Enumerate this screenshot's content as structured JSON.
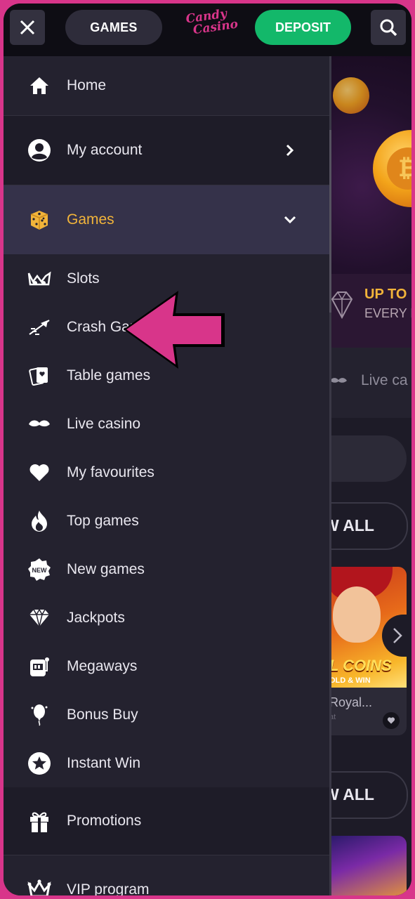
{
  "topbar": {
    "games_label": "GAMES",
    "logo_line1": "Candy",
    "logo_line2": "Casino",
    "deposit_label": "DEPOSIT"
  },
  "menu": {
    "home": "Home",
    "my_account": "My account",
    "games": "Games",
    "games_items": [
      {
        "label": "Slots",
        "icon": "slots-icon"
      },
      {
        "label": "Crash Games",
        "icon": "crash-icon"
      },
      {
        "label": "Table games",
        "icon": "cards-icon"
      },
      {
        "label": "Live casino",
        "icon": "mustache-icon"
      },
      {
        "label": "My favourites",
        "icon": "heart-icon"
      },
      {
        "label": "Top games",
        "icon": "flame-icon"
      },
      {
        "label": "New games",
        "icon": "new-badge-icon"
      },
      {
        "label": "Jackpots",
        "icon": "diamond-icon"
      },
      {
        "label": "Megaways",
        "icon": "slot-machine-icon"
      },
      {
        "label": "Bonus Buy",
        "icon": "balloon-icon"
      },
      {
        "label": "Instant Win",
        "icon": "star-icon"
      }
    ],
    "promotions": "Promotions",
    "vip": "VIP program"
  },
  "background": {
    "banner_up_to": "UP TO",
    "banner_every": "EVERY D",
    "tab_live_casino": "Live ca",
    "view_all_1": "W ALL",
    "game_title_coins": "L COINS",
    "game_hold_win": "OLD & WIN",
    "game_name": "Royal...",
    "game_provider": "at",
    "view_all_2": "W ALL"
  },
  "colors": {
    "frame": "#d8358a",
    "accent_yellow": "#f2b43a",
    "deposit_green": "#13b86a",
    "menu_bg": "#24222f",
    "arrow_pink": "#d8358a"
  }
}
